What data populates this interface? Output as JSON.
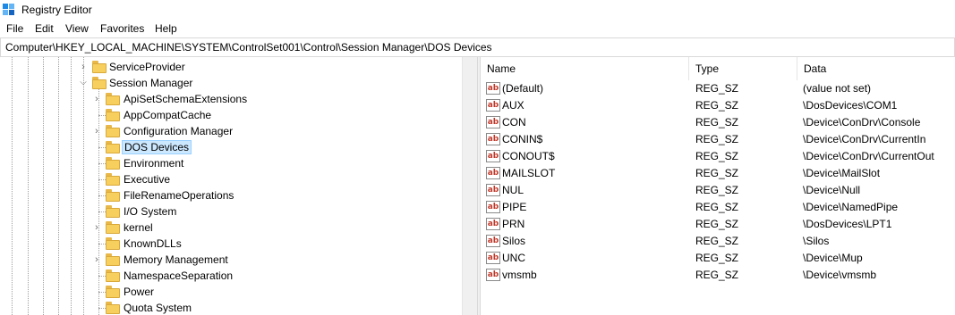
{
  "window": {
    "title": "Registry Editor",
    "icon": "registry-editor-icon"
  },
  "menu": [
    "File",
    "Edit",
    "View",
    "Favorites",
    "Help"
  ],
  "address": "Computer\\HKEY_LOCAL_MACHINE\\SYSTEM\\ControlSet001\\Control\\Session Manager\\DOS Devices",
  "tree": {
    "items": [
      {
        "label": "ServiceProvider",
        "level": 1,
        "expander": "collapsed"
      },
      {
        "label": "Session Manager",
        "level": 1,
        "expander": "expanded"
      },
      {
        "label": "ApiSetSchemaExtensions",
        "level": 2,
        "expander": "collapsed"
      },
      {
        "label": "AppCompatCache",
        "level": 2,
        "expander": "none"
      },
      {
        "label": "Configuration Manager",
        "level": 2,
        "expander": "collapsed"
      },
      {
        "label": "DOS Devices",
        "level": 2,
        "expander": "none",
        "selected": true
      },
      {
        "label": "Environment",
        "level": 2,
        "expander": "none"
      },
      {
        "label": "Executive",
        "level": 2,
        "expander": "none"
      },
      {
        "label": "FileRenameOperations",
        "level": 2,
        "expander": "none"
      },
      {
        "label": "I/O System",
        "level": 2,
        "expander": "none"
      },
      {
        "label": "kernel",
        "level": 2,
        "expander": "collapsed"
      },
      {
        "label": "KnownDLLs",
        "level": 2,
        "expander": "none"
      },
      {
        "label": "Memory Management",
        "level": 2,
        "expander": "collapsed"
      },
      {
        "label": "NamespaceSeparation",
        "level": 2,
        "expander": "none"
      },
      {
        "label": "Power",
        "level": 2,
        "expander": "none"
      },
      {
        "label": "Quota System",
        "level": 2,
        "expander": "none"
      }
    ]
  },
  "list": {
    "columns": [
      "Name",
      "Type",
      "Data"
    ],
    "rows": [
      {
        "name": "(Default)",
        "type": "REG_SZ",
        "data": "(value not set)"
      },
      {
        "name": "AUX",
        "type": "REG_SZ",
        "data": "\\DosDevices\\COM1"
      },
      {
        "name": "CON",
        "type": "REG_SZ",
        "data": "\\Device\\ConDrv\\Console"
      },
      {
        "name": "CONIN$",
        "type": "REG_SZ",
        "data": "\\Device\\ConDrv\\CurrentIn"
      },
      {
        "name": "CONOUT$",
        "type": "REG_SZ",
        "data": "\\Device\\ConDrv\\CurrentOut"
      },
      {
        "name": "MAILSLOT",
        "type": "REG_SZ",
        "data": "\\Device\\MailSlot"
      },
      {
        "name": "NUL",
        "type": "REG_SZ",
        "data": "\\Device\\Null"
      },
      {
        "name": "PIPE",
        "type": "REG_SZ",
        "data": "\\Device\\NamedPipe"
      },
      {
        "name": "PRN",
        "type": "REG_SZ",
        "data": "\\DosDevices\\LPT1"
      },
      {
        "name": "Silos",
        "type": "REG_SZ",
        "data": "\\Silos"
      },
      {
        "name": "UNC",
        "type": "REG_SZ",
        "data": "\\Device\\Mup"
      },
      {
        "name": "vmsmb",
        "type": "REG_SZ",
        "data": "\\Device\\vmsmb"
      }
    ],
    "value_icon": "string-value-icon",
    "value_icon_text": "ab"
  },
  "colors": {
    "selection": "#cce8ff",
    "selection_border": "#99d1ff",
    "folder": "#f7cf5e"
  }
}
